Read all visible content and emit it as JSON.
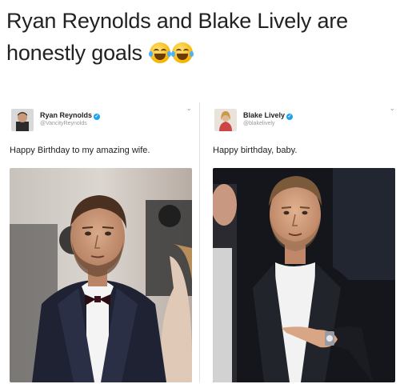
{
  "caption": {
    "text": "Ryan Reynolds and Blake Lively are honestly goals",
    "emojis": [
      "face-with-tears-of-joy-icon",
      "face-with-tears-of-joy-icon"
    ]
  },
  "left_tweet": {
    "name": "Ryan Reynolds",
    "handle": "@VancityReynolds",
    "text": "Happy Birthday to my amazing wife.",
    "photo": "man-in-tuxedo-with-bowtie-red-carpet"
  },
  "right_tweet": {
    "name": "Blake Lively",
    "handle": "@blakelively",
    "text": "Happy birthday, baby.",
    "photo": "man-in-dark-suit-pointing-at-watch"
  },
  "colors": {
    "verified": "#1da1f2",
    "text": "#222222",
    "handle": "#999999"
  }
}
